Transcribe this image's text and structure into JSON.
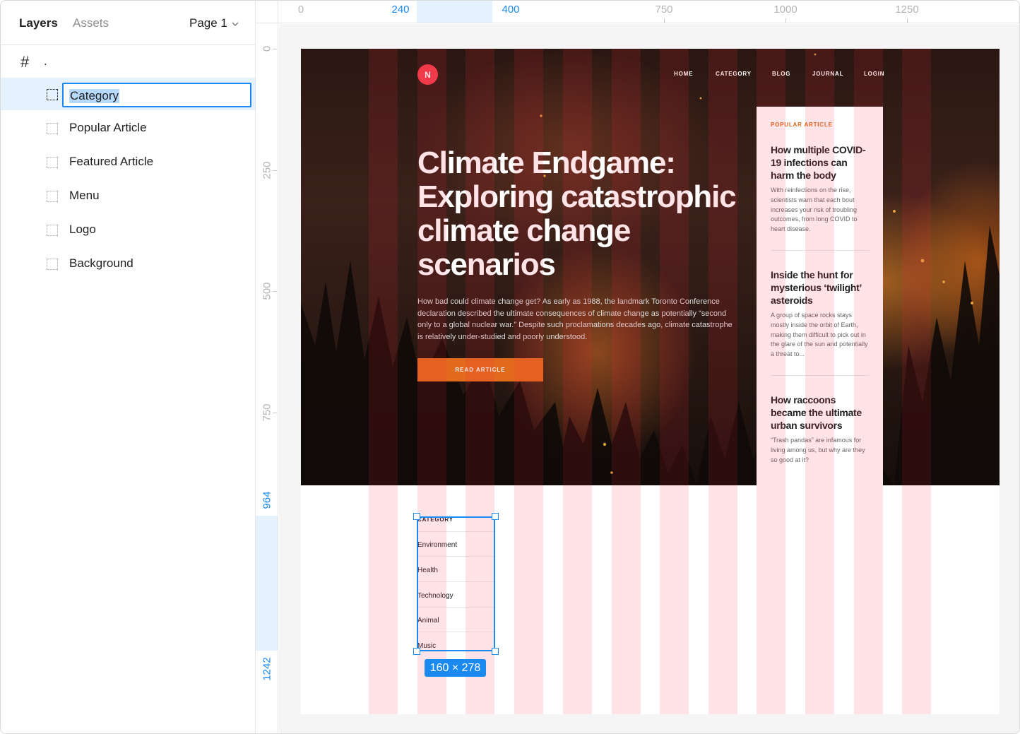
{
  "sidebar": {
    "tabs": {
      "layers": "Layers",
      "assets": "Assets"
    },
    "page": "Page 1",
    "frame_name": ".",
    "layers": [
      {
        "name": "Category",
        "selected": true
      },
      {
        "name": "Popular Article"
      },
      {
        "name": "Featured Article"
      },
      {
        "name": "Menu"
      },
      {
        "name": "Logo"
      },
      {
        "name": "Background"
      }
    ]
  },
  "ruler": {
    "top_labels": [
      "0",
      "240",
      "400",
      "750",
      "1000",
      "1250"
    ],
    "left_labels": [
      "0",
      "250",
      "500",
      "750",
      "964",
      "1242"
    ]
  },
  "design": {
    "logo_letter": "N",
    "nav": [
      "HOME",
      "CATEGORY",
      "BLOG",
      "JOURNAL",
      "LOGIN"
    ],
    "hero_title": "Climate Endgame: Exploring catastrophic climate change scenarios",
    "hero_text": "How bad could climate change get? As early as 1988, the landmark Toronto Conference declaration described the ultimate consequences of climate change as potentially “second only to a global nuclear war.” Despite such proclamations decades ago, climate catastrophe is relatively under-studied and poorly understood.",
    "read_button": "READ ARTICLE",
    "popular_label": "POPULAR ARTICLE",
    "articles": [
      {
        "title": "How multiple COVID-19 infections can harm the body",
        "text": "With reinfections on the rise, scientists warn that each bout increases your risk of troubling outcomes, from long COVID to heart disease."
      },
      {
        "title": "Inside the hunt for mysterious ‘twilight’ asteroids",
        "text": "A group of space rocks stays mostly inside the orbit of Earth, making them difficult to pick out in the glare of the sun and potentially a threat to..."
      },
      {
        "title": "How raccoons became the ultimate urban survivors",
        "text": "“Trash pandas” are infamous for living among us, but why are they so good at it?"
      }
    ],
    "category_heading": "CATEGORY",
    "categories": [
      "Environment",
      "Health",
      "Technology",
      "Animal",
      "Music"
    ]
  },
  "selection": {
    "size_label": "160 × 278"
  },
  "colors": {
    "accent": "#1a8af0",
    "brand_orange": "#e26a1d",
    "logo_red": "#ef3f4c",
    "grid_overlay": "#ffdfe2"
  }
}
